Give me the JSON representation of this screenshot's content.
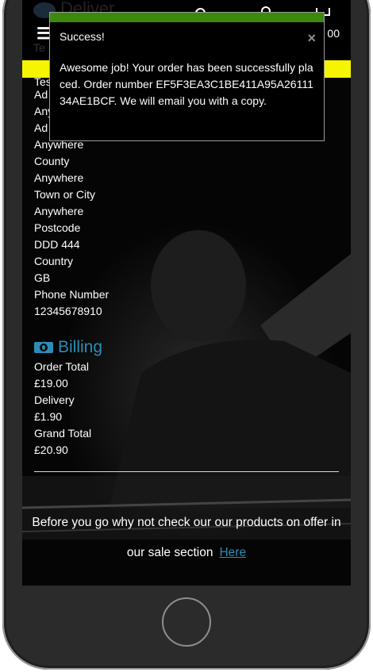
{
  "header": {
    "logo_text": "Deliver",
    "sub_text": "Te",
    "cart_total": "00"
  },
  "details": [
    "Tes",
    "Ad",
    "Any",
    "Ad",
    "Anywhere",
    "County",
    "Anywhere",
    "Town or City",
    "Anywhere",
    "Postcode",
    "DDD 444",
    "Country",
    "GB",
    "Phone Number",
    "12345678910"
  ],
  "billing": {
    "heading": "Billing",
    "rows": [
      "Order Total",
      "£19.00",
      "Delivery",
      "£1.90",
      "Grand Total",
      "£20.90"
    ]
  },
  "promo": {
    "text": "Before you go why not check our our products on offer in our sale section",
    "link": "Here"
  },
  "toast": {
    "title": "Success!",
    "close": "×",
    "message": "Awesome job! Your order has been successfully placed. Order number EF5F3EA3C1BE411A95A2611134AE1BCF. We will email you with a copy."
  },
  "colors": {
    "accent": "#2c8cb6",
    "success": "#3b8a0c",
    "banner": "#f5f500"
  },
  "icons": [
    "menu-icon",
    "search-icon",
    "user-icon",
    "cart-icon",
    "billing-icon",
    "close-icon"
  ]
}
